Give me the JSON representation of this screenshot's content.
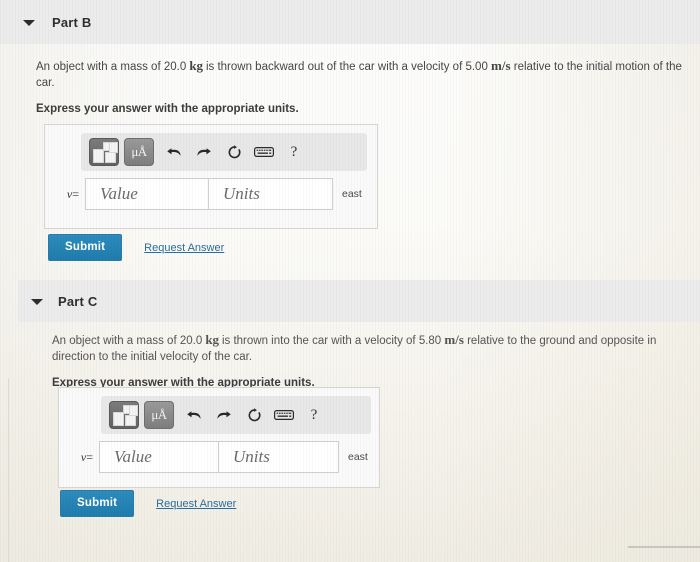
{
  "parts": [
    {
      "id": "b",
      "title": "Part B",
      "caret_icon": "caret-down-icon",
      "question_pre": "An object with a mass of 20.0 ",
      "question_unit_mass": "kg",
      "question_mid": " is thrown backward out of the car with a velocity of 5.00 ",
      "question_unit_velocity": "m/s",
      "question_post": " relative to the initial motion of the car.",
      "instruction": "Express your answer with the appropriate units.",
      "toolbar": {
        "template_button": "template-matrix-icon",
        "unit_button_label": "μÅ",
        "undo_icon": "undo-arrow-icon",
        "redo_icon": "redo-arrow-icon",
        "reset_icon": "reset-circular-arrow-icon",
        "keyboard_icon": "keyboard-icon",
        "help_label": "?"
      },
      "variable_label": "v",
      "equals_sign": "=",
      "value_placeholder": "Value",
      "units_placeholder": "Units",
      "value_text": "",
      "units_text": "",
      "direction_label": "east",
      "submit_label": "Submit",
      "request_answer_label": "Request Answer"
    },
    {
      "id": "c",
      "title": "Part C",
      "caret_icon": "caret-down-icon",
      "question_pre": "An object with a mass of 20.0 ",
      "question_unit_mass": "kg",
      "question_mid": " is thrown into the car with a velocity of 5.80 ",
      "question_unit_velocity": "m/s",
      "question_post": " relative to the ground and opposite in direction to the initial velocity of the car.",
      "instruction": "Express your answer with the appropriate units.",
      "toolbar": {
        "template_button": "template-matrix-icon",
        "unit_button_label": "μÅ",
        "undo_icon": "undo-arrow-icon",
        "redo_icon": "redo-arrow-icon",
        "reset_icon": "reset-circular-arrow-icon",
        "keyboard_icon": "keyboard-icon",
        "help_label": "?"
      },
      "variable_label": "v",
      "equals_sign": "=",
      "value_placeholder": "Value",
      "units_placeholder": "Units",
      "value_text": "",
      "units_text": "",
      "direction_label": "east",
      "submit_label": "Submit",
      "request_answer_label": "Request Answer"
    }
  ],
  "colors": {
    "submit_blue": "#1f7dad",
    "link_blue": "#2a6f9e",
    "header_band": "#ececec",
    "toolbar_gray": "#e8e8e8",
    "button_dark": "#636363"
  }
}
